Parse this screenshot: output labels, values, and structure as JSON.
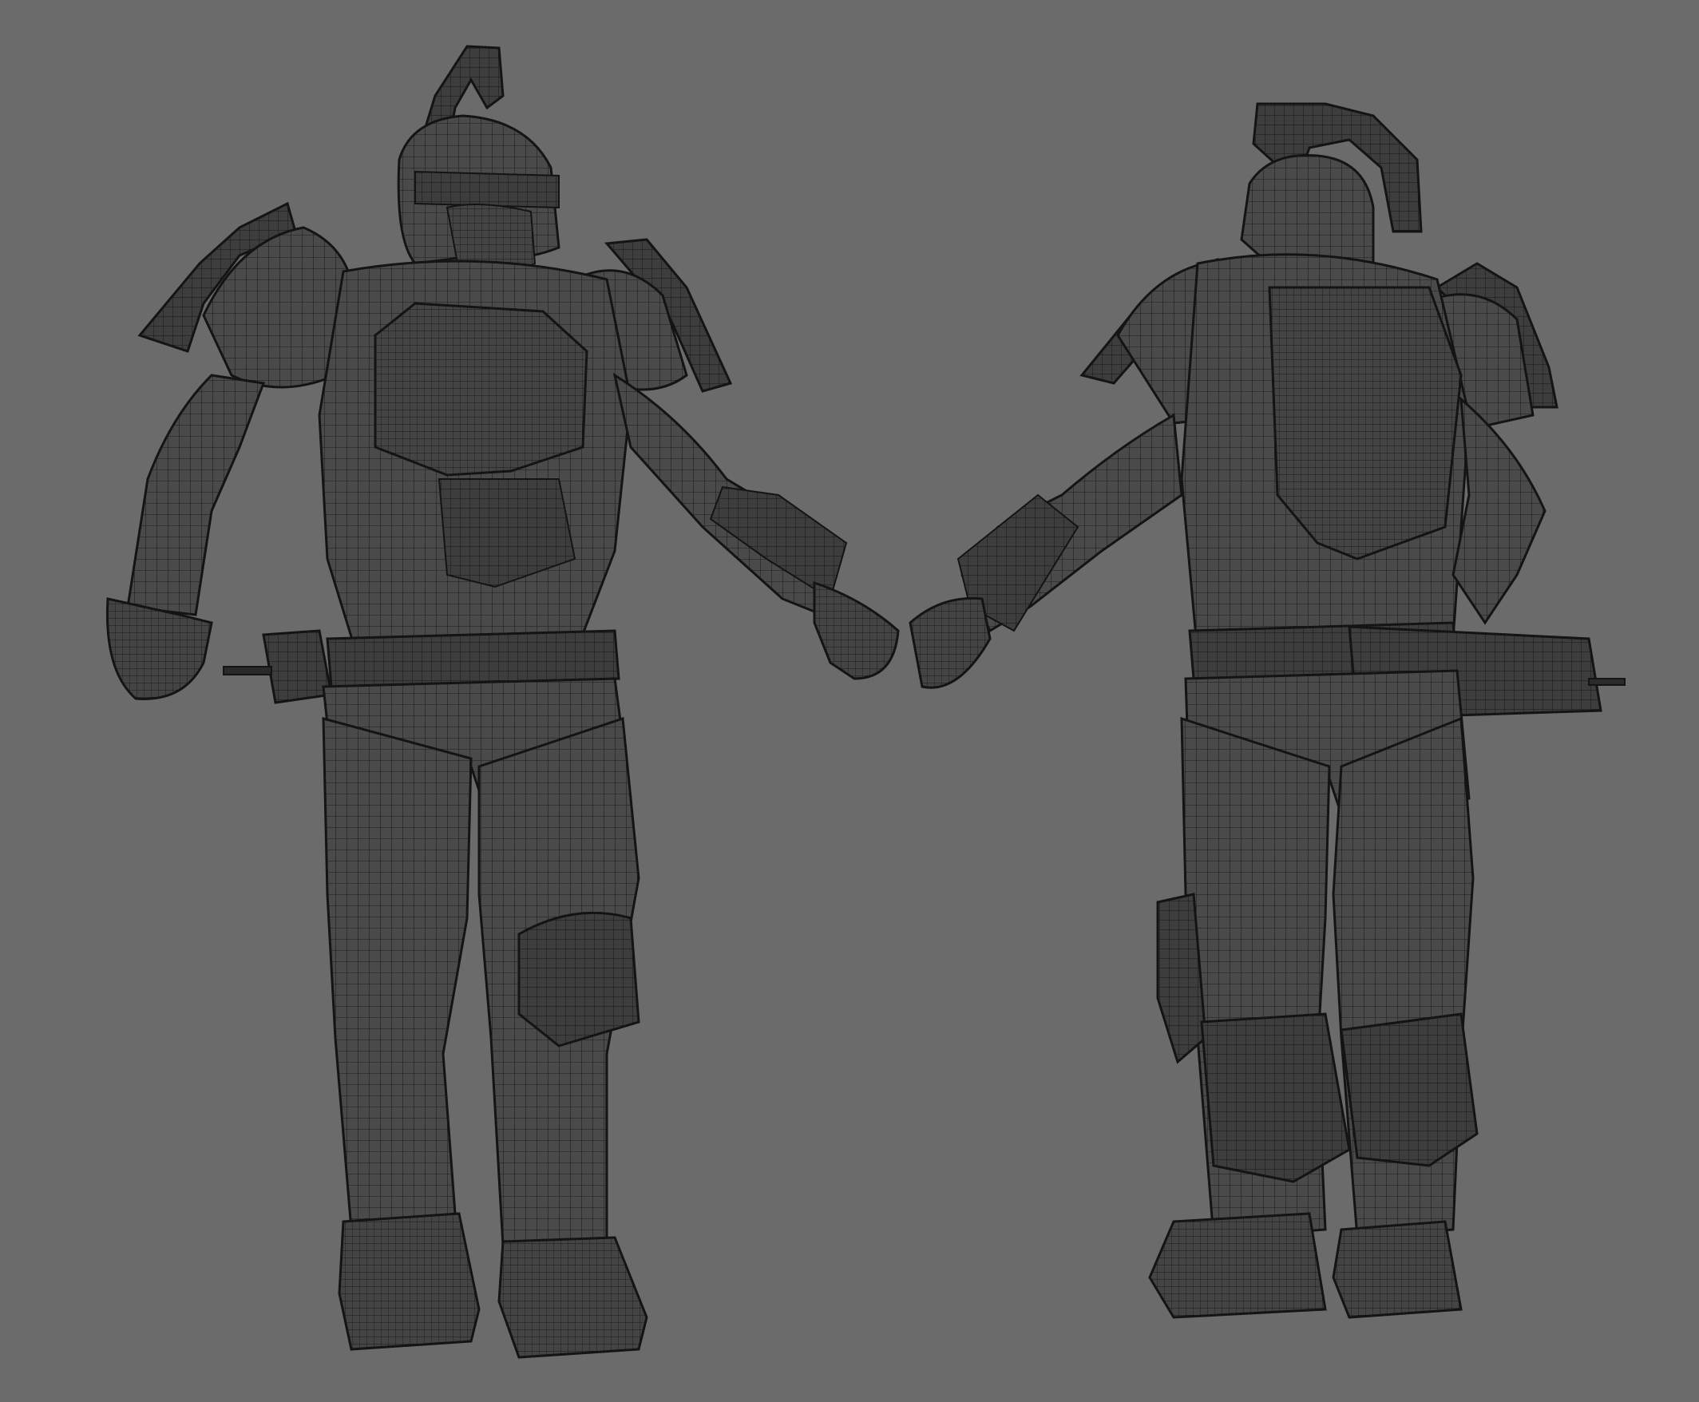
{
  "viewport": {
    "background_color": "#6b6b6b",
    "mesh_fill_color": "#4a4a4a",
    "mesh_fill_dark": "#3a3a3a",
    "wire_color": "#1c1c1c",
    "outline_color": "#141414"
  },
  "models": [
    {
      "view": "front"
    },
    {
      "view": "back"
    }
  ]
}
